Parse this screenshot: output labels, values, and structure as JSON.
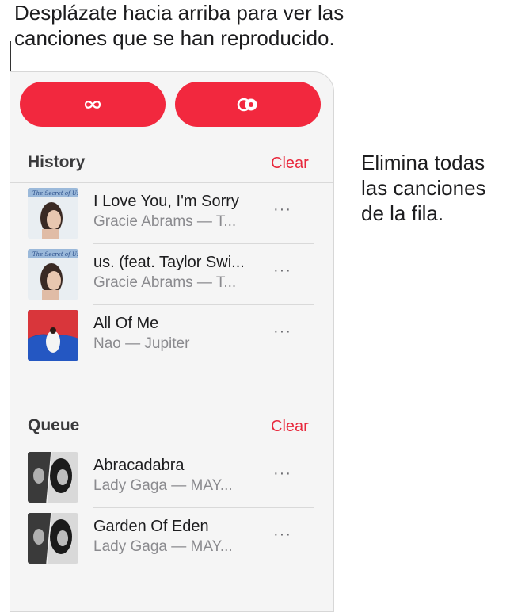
{
  "callouts": {
    "top": "Desplázate hacia arriba para ver las\ncanciones que se han reproducido.",
    "right": "Elimina todas\nlas canciones\nde la fila."
  },
  "buttons": {
    "autoplay_icon": "infinity-icon",
    "repeat_icon": "autoplay-circles-icon",
    "accent_color": "#f2283e"
  },
  "history": {
    "title": "History",
    "clear_label": "Clear",
    "items": [
      {
        "song": "I Love You, I'm Sorry",
        "artist": "Gracie Abrams — T...",
        "more": "···"
      },
      {
        "song": "us. (feat. Taylor Swi...",
        "artist": "Gracie Abrams — T...",
        "more": "···"
      },
      {
        "song": "All Of Me",
        "artist": "Nao — Jupiter",
        "more": "···"
      }
    ]
  },
  "queue": {
    "title": "Queue",
    "clear_label": "Clear",
    "items": [
      {
        "song": "Abracadabra",
        "artist": "Lady Gaga — MAY...",
        "more": "···"
      },
      {
        "song": "Garden Of Eden",
        "artist": "Lady Gaga — MAY...",
        "more": "···"
      }
    ]
  }
}
